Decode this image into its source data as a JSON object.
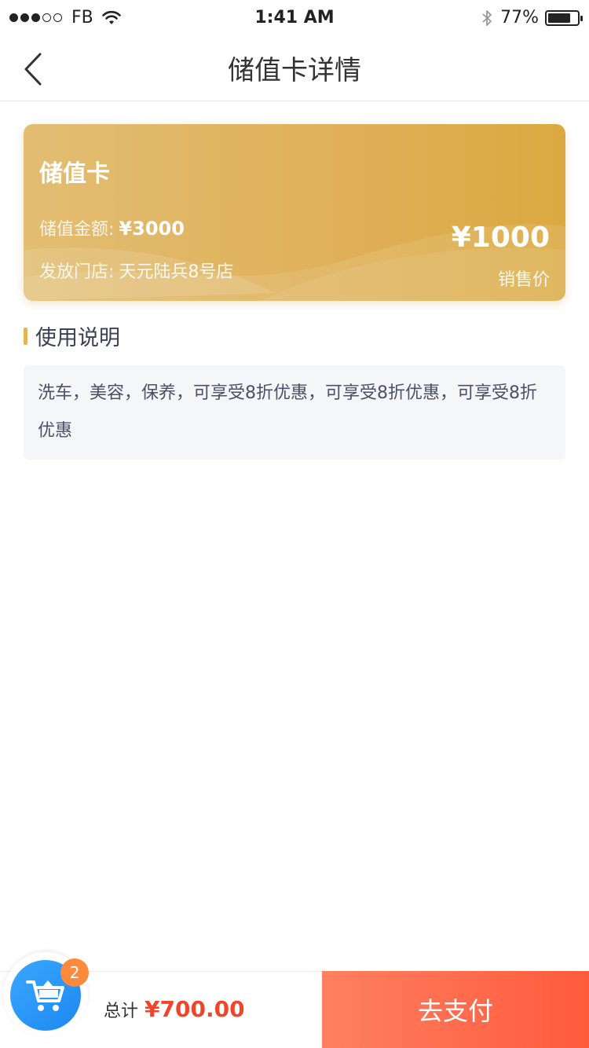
{
  "status_bar": {
    "carrier": "FB",
    "time": "1:41 AM",
    "battery_percent": "77%",
    "battery_level": 0.77,
    "signal_bars_filled": 3,
    "signal_bars_total": 5
  },
  "nav": {
    "title": "储值卡详情",
    "back_icon": "chevron-left-icon"
  },
  "card": {
    "title": "储值卡",
    "amount_label": "储值金额:",
    "amount_value": "¥3000",
    "store_label": "发放门店:",
    "store_value": "天元陆兵8号店",
    "price": "¥1000",
    "price_label": "销售价",
    "colors": {
      "gradient_start": "#e2bd72",
      "gradient_end": "#dba940"
    }
  },
  "usage": {
    "title": "使用说明",
    "description": "洗车，美容，保养，可享受8折优惠，可享受8折优惠，可享受8折优惠"
  },
  "bottom_bar": {
    "cart_icon": "shopping-cart-icon",
    "cart_count": "2",
    "total_label": "总计",
    "total_amount": "¥700.00",
    "pay_label": "去支付",
    "colors": {
      "total": "#f0452a",
      "pay_start": "#ff8060",
      "pay_end": "#ff5a3c",
      "cart": "#1d87f0",
      "badge": "#ff8a3c"
    }
  }
}
